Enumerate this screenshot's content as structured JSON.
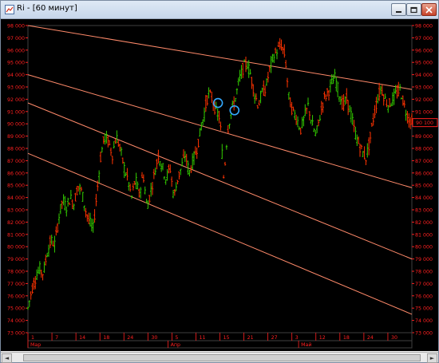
{
  "window": {
    "title": "Ri - [60 минут]",
    "icon": "chart-window-icon",
    "buttons": [
      "minimize-icon",
      "maximize-icon",
      "close-icon"
    ]
  },
  "scrollbar": {
    "left_arrow": "◄",
    "right_arrow": "►"
  },
  "colors": {
    "background": "#000000",
    "axis_text": "#ff2020",
    "channel_lines": "#ff8a6a",
    "bull": "#33cc00",
    "bear": "#ff3300",
    "markers": "#33aaff"
  },
  "chart_data": {
    "type": "line",
    "y_labels": [
      "73 000",
      "74 000",
      "75 000",
      "76 000",
      "77 000",
      "78 000",
      "79 000",
      "80 000",
      "81 000",
      "82 000",
      "83 000",
      "84 000",
      "85 000",
      "86 000",
      "87 000",
      "88 000",
      "89 000",
      "90 000",
      "91 000",
      "92 000",
      "93 000",
      "94 000",
      "95 000",
      "96 000",
      "97 000",
      "98 000"
    ],
    "ylim": [
      73000,
      98000
    ],
    "last_price_label": "90 100",
    "x_day_labels": [
      "1",
      "7",
      "14",
      "18",
      "24",
      "30",
      "5",
      "11",
      "15",
      "21",
      "27",
      "3",
      "12",
      "18",
      "24",
      "30"
    ],
    "x_month_labels": [
      "Мар",
      "Апр",
      "Май"
    ],
    "channel_lines": [
      {
        "name": "upper",
        "y_start": 98000,
        "y_end": 92800
      },
      {
        "name": "mid1",
        "y_start": 94000,
        "y_end": 84800
      },
      {
        "name": "mid2",
        "y_start": 91700,
        "y_end": 79000
      },
      {
        "name": "lower",
        "y_start": 87600,
        "y_end": 74500
      }
    ],
    "marker_points": [
      [
        0.495,
        91700
      ],
      [
        0.538,
        91100
      ]
    ],
    "series": [
      {
        "y": [
          75000,
          76500,
          77500,
          78200,
          77800,
          79500,
          80500,
          80200,
          82300,
          83800,
          83200,
          84000,
          83500,
          85000,
          84500,
          83000,
          82000,
          81500,
          84500,
          87500,
          89000,
          88500,
          87500,
          89000,
          88000,
          86500,
          85500,
          84000,
          85500,
          84200,
          86000,
          83200,
          84500,
          86000,
          87500,
          86500,
          85500,
          86500,
          84000,
          85500,
          86500,
          87500,
          86000,
          87000,
          88000,
          89500,
          91000,
          92500,
          92000,
          91000,
          90500,
          85500,
          89500,
          91000,
          92000,
          93500,
          94500,
          95000,
          94000,
          92500,
          91500,
          92500,
          93000,
          94500,
          95500,
          96000,
          96400,
          95500,
          92000,
          91000,
          90500,
          89500,
          90500,
          91500,
          90000,
          89000,
          90500,
          92000,
          92500,
          93200,
          93800,
          92500,
          91500,
          92000,
          91000,
          89500,
          88500,
          87800,
          87200,
          88500,
          90500,
          92000,
          93000,
          92000,
          91500,
          92000,
          92500,
          92800,
          91500,
          90500,
          90200
        ]
      }
    ]
  }
}
